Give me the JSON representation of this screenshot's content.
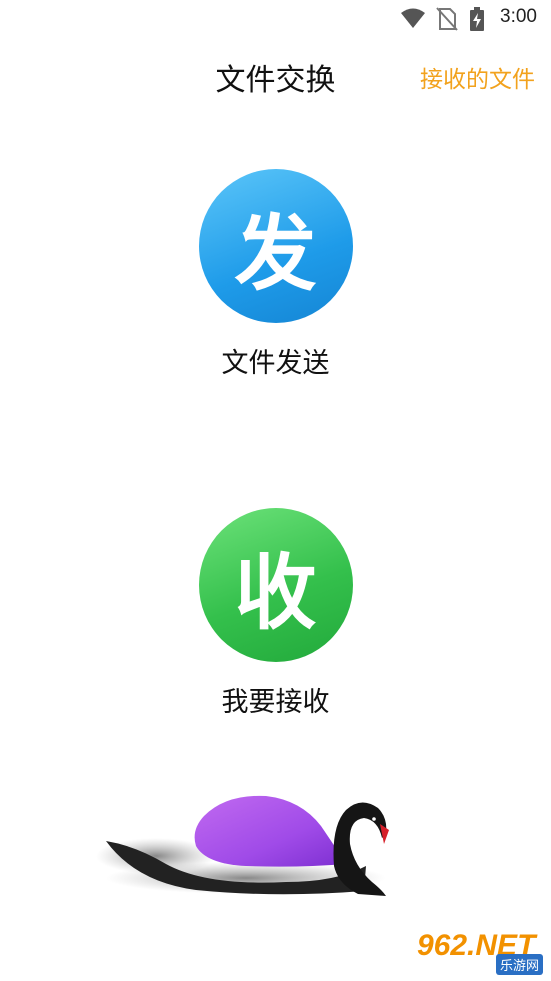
{
  "status_bar": {
    "time": "3:00",
    "icons": [
      "wifi-icon",
      "no-sim-icon",
      "battery-charging-icon"
    ]
  },
  "header": {
    "title": "文件交换",
    "received_files_link": "接收的文件"
  },
  "actions": {
    "send": {
      "glyph": "发",
      "label": "文件发送",
      "color": "#1e9be9"
    },
    "receive": {
      "glyph": "收",
      "label": "我要接收",
      "color": "#34c04c"
    }
  },
  "watermark": {
    "text": "962.NET",
    "sub": "乐游网"
  },
  "colors": {
    "accent": "#f2a21d"
  }
}
